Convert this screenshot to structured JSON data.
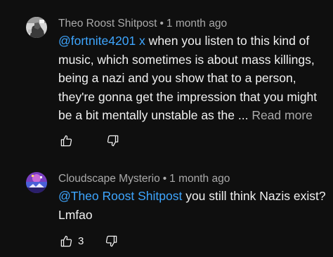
{
  "comments": [
    {
      "author": "Theo Roost Shitpost",
      "separator": "•",
      "time": "1 month ago",
      "mention": "@fortnite4201 x",
      "text": " when you listen to this kind of music, which sometimes is about mass killings, being a nazi and you show that to a person, they're gonna get the impression that you might be a bit mentally unstable as the ... ",
      "read_more": "Read more",
      "like_icon": "thumbs-up-icon",
      "dislike_icon": "thumbs-down-icon"
    },
    {
      "author": "Cloudscape Mysterio",
      "separator": "•",
      "time": "1 month ago",
      "mention": "@Theo Roost Shitpost",
      "text": " you still think Nazis exist? Lmfao",
      "like_count": "3",
      "like_icon": "thumbs-up-icon",
      "dislike_icon": "thumbs-down-icon"
    }
  ],
  "colors": {
    "background": "#0f0f0f",
    "text": "#f1f1f1",
    "secondary_text": "#aaaaaa",
    "mention": "#3ea6ff"
  }
}
